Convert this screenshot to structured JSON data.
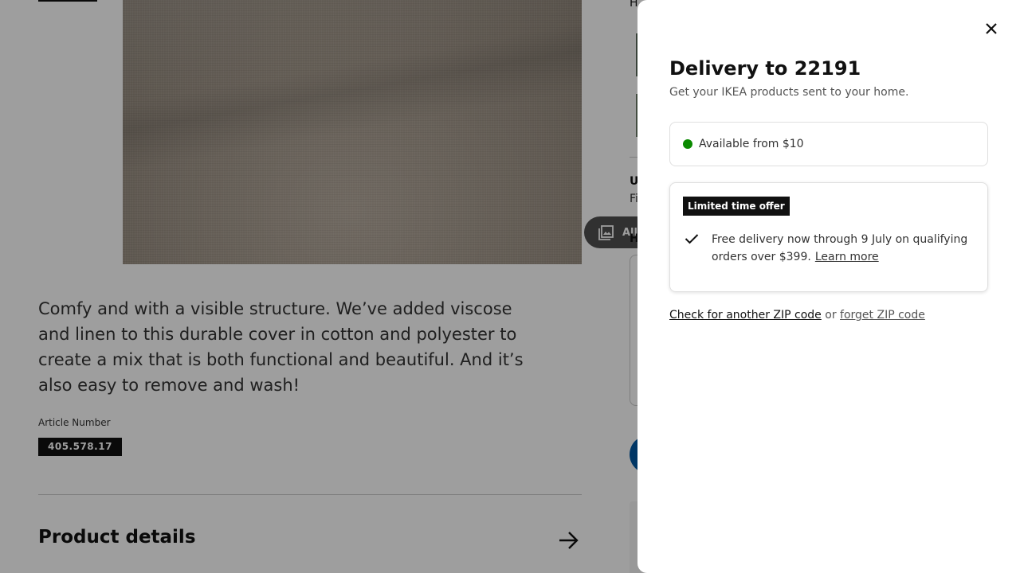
{
  "background_page": {
    "all_media_label": "All media",
    "description": "Comfy and with a visible structure. We’ve added viscose and linen to this durable cover in cotton and polyester to create a mix that is both functional and beautiful. And it’s also easy to remove and wash!",
    "article_label": "Article Number",
    "article_number": "405.578.17",
    "product_details_title": "Product details",
    "right_col_top": "H",
    "right_col_heading_1": "U",
    "right_col_text_1": "Fi",
    "right_col_heading_2": "H"
  },
  "modal": {
    "title": "Delivery to 22191",
    "subtitle": "Get your IKEA products sent to your home.",
    "availability": {
      "text": "Available from $10",
      "status_color": "#0a8a00"
    },
    "offer": {
      "badge": "Limited time offer",
      "text": "Free delivery now through 9 July on qualifying orders over $399.",
      "learn_more": "Learn more"
    },
    "zip": {
      "check_link": "Check for another ZIP code",
      "or_text": "or",
      "forget_link": "forget ZIP code"
    },
    "close_icon": "close-icon"
  },
  "colors": {
    "brand_blue": "#0058a3",
    "available_green": "#0a8a00",
    "badge_black": "#111111"
  }
}
